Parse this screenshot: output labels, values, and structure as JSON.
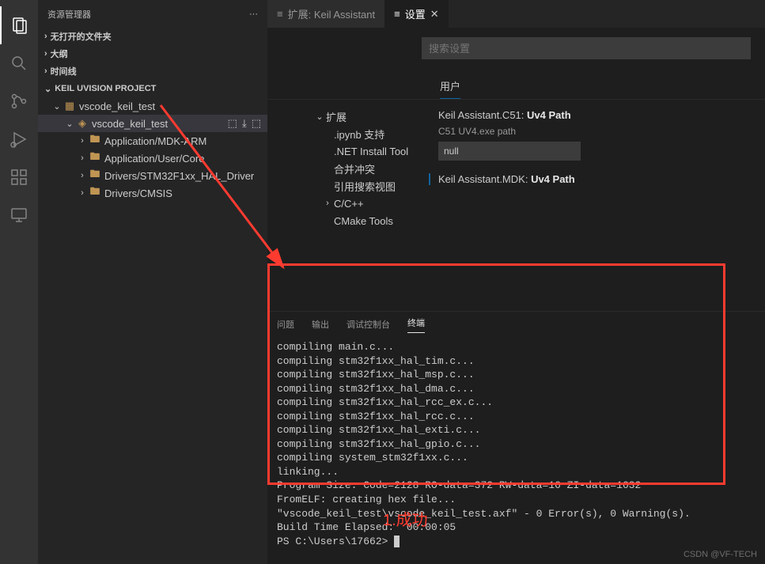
{
  "sidebar": {
    "title": "资源管理器",
    "sections": {
      "noOpen": "无打开的文件夹",
      "outline": "大纲",
      "timeline": "时间线",
      "keilProject": "KEIL UVISION PROJECT"
    },
    "tree": {
      "project": "vscode_keil_test",
      "target": "vscode_keil_test",
      "folders": [
        "Application/MDK-ARM",
        "Application/User/Core",
        "Drivers/STM32F1xx_HAL_Driver",
        "Drivers/CMSIS"
      ]
    }
  },
  "editorTabs": [
    {
      "icon": "≡",
      "label": "扩展: Keil Assistant",
      "closable": false,
      "active": false
    },
    {
      "icon": "≡",
      "label": "设置",
      "closable": true,
      "active": true
    }
  ],
  "settings": {
    "searchPlaceholder": "搜索设置",
    "userTab": "用户",
    "nav": {
      "ext": "扩展",
      "items": [
        ".ipynb 支持",
        ".NET Install Tool",
        "合并冲突",
        "引用搜索视图"
      ],
      "ccpp": "C/C++",
      "cmake": "CMake Tools"
    },
    "items": [
      {
        "prefix": "Keil Assistant.C51:",
        "name": "Uv4 Path",
        "desc": "C51 UV4.exe path",
        "value": "null"
      },
      {
        "prefix": "Keil Assistant.MDK:",
        "name": "Uv4 Path"
      }
    ]
  },
  "panel": {
    "tabs": [
      "问题",
      "输出",
      "调试控制台",
      "终端"
    ],
    "activeTab": 3,
    "terminalLines": [
      "compiling main.c...",
      "compiling stm32f1xx_hal_tim.c...",
      "compiling stm32f1xx_hal_msp.c...",
      "compiling stm32f1xx_hal_dma.c...",
      "compiling stm32f1xx_hal_rcc_ex.c...",
      "compiling stm32f1xx_hal_rcc.c...",
      "compiling stm32f1xx_hal_exti.c...",
      "compiling stm32f1xx_hal_gpio.c...",
      "compiling system_stm32f1xx.c...",
      "linking...",
      "Program Size: Code=2128 RO-data=372 RW-data=16 ZI-data=1632",
      "FromELF: creating hex file...",
      "\"vscode_keil_test\\vscode_keil_test.axf\" - 0 Error(s), 0 Warning(s).",
      "Build Time Elapsed:  00:00:05"
    ],
    "prompt": "PS C:\\Users\\17662> "
  },
  "annotations": {
    "successLabel": "1.成功",
    "watermark": "CSDN @VF-TECH"
  }
}
